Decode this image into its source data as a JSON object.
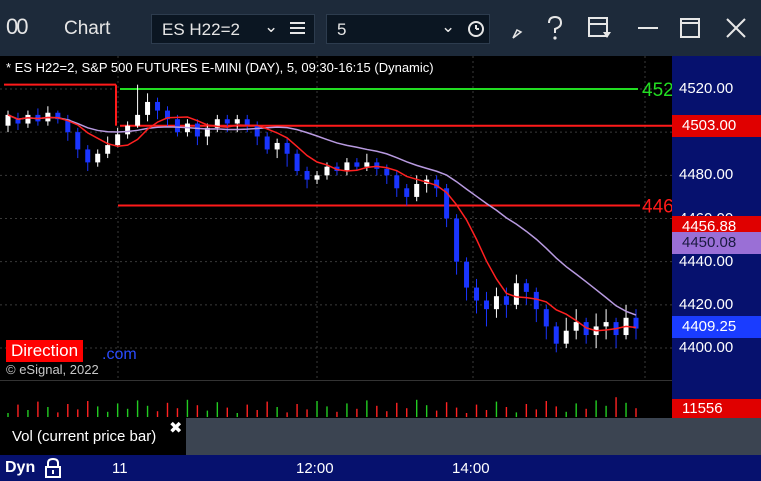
{
  "titlebar": {
    "app_icon": "00",
    "title": "Chart",
    "symbol": "ES H22=2",
    "interval": "5",
    "icons": [
      "chevron-down-icon",
      "list-icon",
      "chevron-down-icon",
      "clock-icon",
      "draw-tool-icon",
      "help-icon",
      "save-layout-icon",
      "minimize-icon",
      "maximize-icon",
      "close-icon"
    ]
  },
  "chart": {
    "header": "* ES H22=2, S&P 500 FUTURES E-MINI (DAY), 5, 09:30-16:15 (Dynamic)",
    "direction_label": "Direction",
    "partial_link": ".com",
    "copyright": "© eSignal, 2022",
    "level_labels": [
      "452",
      "446"
    ],
    "y_ticks": [
      "4520.00",
      "4500.00",
      "4480.00",
      "4460.00",
      "4440.00",
      "4420.00",
      "4400.00"
    ],
    "price_tags": [
      {
        "text": "4503.00",
        "bg": "#e00000",
        "color": "#ffffff"
      },
      {
        "text": "4456.88",
        "bg": "#e00000",
        "color": "#ffffff"
      },
      {
        "text": "4450.08",
        "bg": "#9a6fd6",
        "color": "#1a1a40"
      },
      {
        "text": "4409.25",
        "bg": "#1a3cff",
        "color": "#ffffff"
      }
    ],
    "x_ticks": [
      "11",
      "12:00",
      "14:00"
    ]
  },
  "volume": {
    "label": "Vol (current price bar)",
    "close_symbol": "✖",
    "last_value": "11556"
  },
  "bottom": {
    "dyn": "Dyn"
  },
  "colors": {
    "titlebar": "#1d2a3a",
    "axis": "#06116e",
    "up_candle": "#ffffff",
    "down_candle": "#1a35ff",
    "ma_red": "#ff2020",
    "ma_purple": "#b89ae0",
    "level_green": "#22dd22",
    "level_red": "#ff1a1a"
  },
  "chart_data": {
    "type": "candlestick",
    "y_range": [
      4390,
      4530
    ],
    "levels": [
      {
        "price": 4520,
        "color": "green",
        "label": "452"
      },
      {
        "price": 4503,
        "color": "red",
        "label": "4503.00"
      },
      {
        "price": 4466,
        "color": "red",
        "label": "446"
      },
      {
        "price": 4456.88,
        "color": "red",
        "label": "4456.88"
      }
    ],
    "candles": [
      [
        4503,
        4508,
        4500,
        4510
      ],
      [
        4506,
        4504,
        4501,
        4509
      ],
      [
        4504,
        4508,
        4502,
        4510
      ],
      [
        4508,
        4505,
        4503,
        4511
      ],
      [
        4505,
        4509,
        4503,
        4512
      ],
      [
        4509,
        4506,
        4504,
        4510
      ],
      [
        4506,
        4500,
        4496,
        4508
      ],
      [
        4500,
        4492,
        4488,
        4502
      ],
      [
        4492,
        4486,
        4482,
        4494
      ],
      [
        4486,
        4490,
        4484,
        4492
      ],
      [
        4490,
        4494,
        4488,
        4498
      ],
      [
        4494,
        4499,
        4493,
        4502
      ],
      [
        4499,
        4503,
        4497,
        4505
      ],
      [
        4503,
        4508,
        4502,
        4522
      ],
      [
        4508,
        4514,
        4505,
        4518
      ],
      [
        4514,
        4510,
        4506,
        4516
      ],
      [
        4510,
        4506,
        4503,
        4512
      ],
      [
        4506,
        4500,
        4498,
        4508
      ],
      [
        4500,
        4504,
        4498,
        4506
      ],
      [
        4504,
        4498,
        4494,
        4506
      ],
      [
        4498,
        4502,
        4494,
        4504
      ],
      [
        4502,
        4506,
        4500,
        4508
      ],
      [
        4506,
        4504,
        4500,
        4508
      ],
      [
        4504,
        4506,
        4500,
        4508
      ],
      [
        4506,
        4503,
        4500,
        4508
      ],
      [
        4503,
        4498,
        4494,
        4505
      ],
      [
        4498,
        4492,
        4490,
        4500
      ],
      [
        4492,
        4495,
        4488,
        4497
      ],
      [
        4495,
        4490,
        4484,
        4497
      ],
      [
        4490,
        4482,
        4480,
        4492
      ],
      [
        4482,
        4478,
        4474,
        4484
      ],
      [
        4478,
        4480,
        4476,
        4482
      ],
      [
        4480,
        4484,
        4478,
        4486
      ],
      [
        4484,
        4482,
        4480,
        4486
      ],
      [
        4482,
        4486,
        4480,
        4488
      ],
      [
        4486,
        4484,
        4482,
        4488
      ],
      [
        4484,
        4486,
        4482,
        4490
      ],
      [
        4486,
        4483,
        4480,
        4488
      ],
      [
        4483,
        4480,
        4476,
        4485
      ],
      [
        4480,
        4474,
        4470,
        4482
      ],
      [
        4474,
        4470,
        4466,
        4476
      ],
      [
        4470,
        4476,
        4468,
        4480
      ],
      [
        4476,
        4478,
        4472,
        4480
      ],
      [
        4478,
        4474,
        4470,
        4480
      ],
      [
        4474,
        4460,
        4456,
        4476
      ],
      [
        4460,
        4440,
        4434,
        4462
      ],
      [
        4440,
        4428,
        4422,
        4442
      ],
      [
        4428,
        4422,
        4416,
        4432
      ],
      [
        4422,
        4418,
        4410,
        4426
      ],
      [
        4418,
        4424,
        4414,
        4428
      ],
      [
        4424,
        4420,
        4414,
        4428
      ],
      [
        4420,
        4430,
        4418,
        4434
      ],
      [
        4430,
        4426,
        4420,
        4432
      ],
      [
        4426,
        4418,
        4412,
        4428
      ],
      [
        4418,
        4410,
        4404,
        4420
      ],
      [
        4410,
        4402,
        4398,
        4412
      ],
      [
        4402,
        4408,
        4400,
        4414
      ],
      [
        4408,
        4412,
        4404,
        4418
      ],
      [
        4412,
        4406,
        4402,
        4414
      ],
      [
        4406,
        4410,
        4400,
        4416
      ],
      [
        4410,
        4412,
        4404,
        4418
      ],
      [
        4412,
        4406,
        4400,
        4414
      ],
      [
        4406,
        4414,
        4404,
        4420
      ],
      [
        4414,
        4409,
        4404,
        4418
      ]
    ]
  }
}
